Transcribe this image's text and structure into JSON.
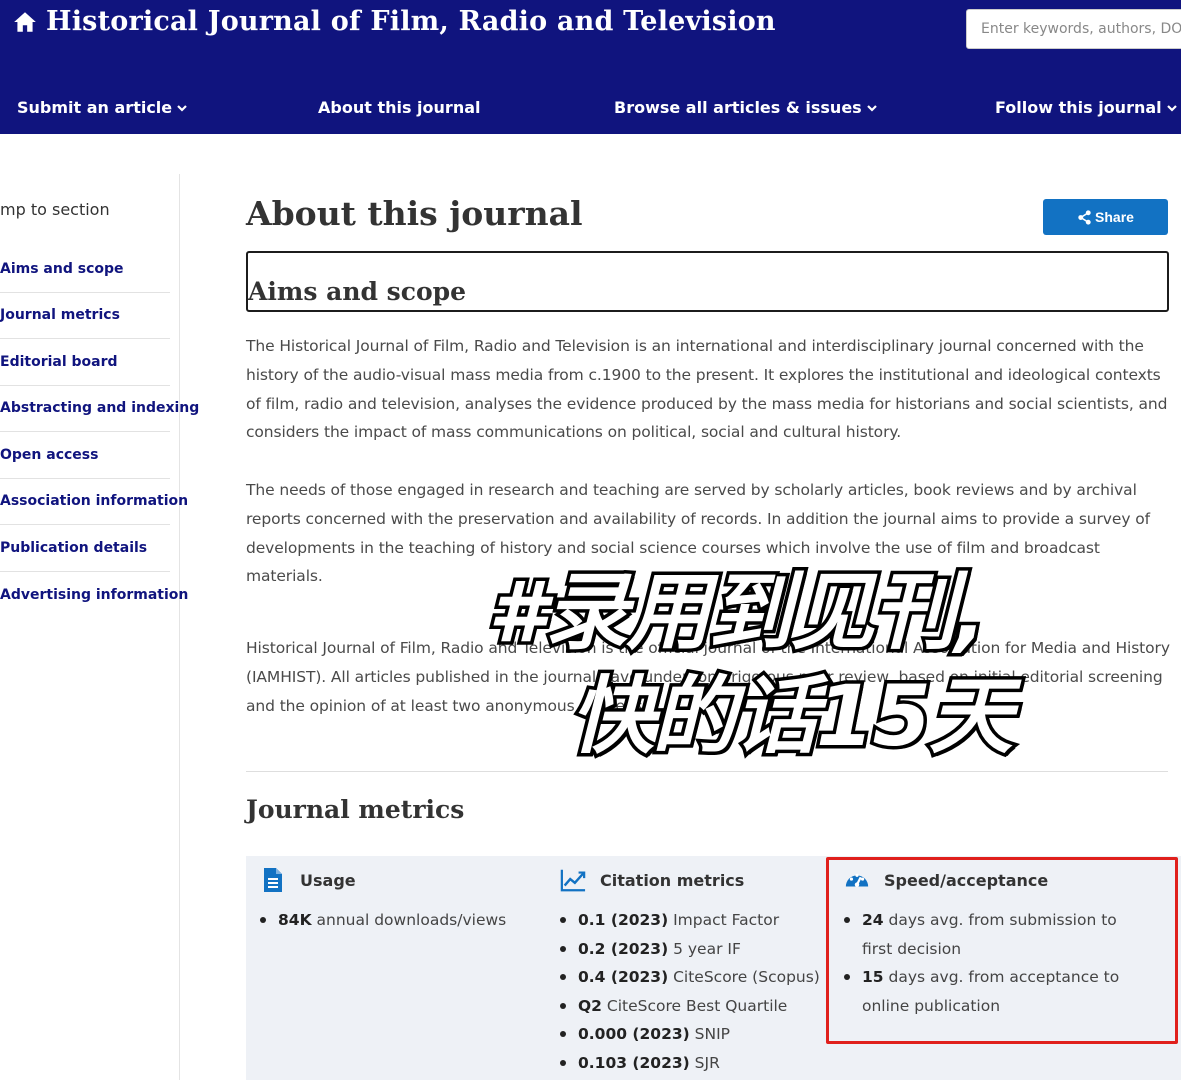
{
  "header": {
    "title": "Historical Journal of Film, Radio and Television",
    "search_placeholder": "Enter keywords, authors, DOI"
  },
  "nav": {
    "items": [
      {
        "label": "Submit an article",
        "dropdown": true
      },
      {
        "label": "About this journal",
        "dropdown": false
      },
      {
        "label": "Browse all articles & issues",
        "dropdown": true
      },
      {
        "label": "Follow this journal",
        "dropdown": true
      }
    ]
  },
  "sidebar": {
    "jump_label": "mp to section",
    "items": [
      {
        "label": "Aims and scope"
      },
      {
        "label": "Journal metrics"
      },
      {
        "label": "Editorial board"
      },
      {
        "label": "Abstracting and indexing"
      },
      {
        "label": "Open access"
      },
      {
        "label": "Association information"
      },
      {
        "label": "Publication details"
      },
      {
        "label": "Advertising information"
      }
    ]
  },
  "main": {
    "title": "About this journal",
    "share_label": "Share",
    "aims_heading": "Aims and scope",
    "paragraphs": [
      "The Historical Journal of Film, Radio and Television is an international and interdisciplinary journal concerned with the history of the audio-visual mass media from c.1900 to the present. It explores the institutional and ideological contexts of film, radio and television, analyses the evidence produced by the mass media for historians and social scientists, and considers the impact of mass communications on political, social and cultural history.",
      "The needs of those engaged in research and teaching are served by scholarly articles, book reviews and by archival reports concerned with the preservation and availability of records. In addition the journal aims to provide a survey of developments in the teaching of history and social science courses which involve the use of film and broadcast materials.",
      "Historical Journal of Film, Radio and Television is the official journal of the International Association for Media and History (IAMHIST). All articles published in the journal have undergone rigorous peer review, based on initial editorial screening and the opinion of at least two anonymous referees."
    ],
    "metrics_title": "Journal metrics"
  },
  "metrics": {
    "usage": {
      "title": "Usage",
      "items": [
        {
          "bold": "84K",
          "text": " annual downloads/views"
        }
      ]
    },
    "citation": {
      "title": "Citation metrics",
      "items": [
        {
          "bold": "0.1 (2023)",
          "text": " Impact Factor"
        },
        {
          "bold": "0.2 (2023)",
          "text": " 5 year IF"
        },
        {
          "bold": "0.4 (2023)",
          "text": " CiteScore (Scopus)"
        },
        {
          "bold": "Q2",
          "text": " CiteScore Best Quartile"
        },
        {
          "bold": "0.000 (2023)",
          "text": " SNIP"
        },
        {
          "bold": "0.103 (2023)",
          "text": " SJR"
        }
      ]
    },
    "speed": {
      "title": "Speed/acceptance",
      "items": [
        {
          "bold": "24",
          "text": " days avg. from submission to first decision"
        },
        {
          "bold": "15",
          "text": " days avg. from acceptance to online publication"
        }
      ]
    }
  },
  "overlay": {
    "line1": "#录用到见刊,",
    "line2": "快的话15天"
  },
  "colors": {
    "header_bg": "#10147e",
    "link": "#10147e",
    "share_bg": "#1272c3",
    "highlight_border": "#e0201c",
    "metrics_bg": "#eef1f6"
  }
}
